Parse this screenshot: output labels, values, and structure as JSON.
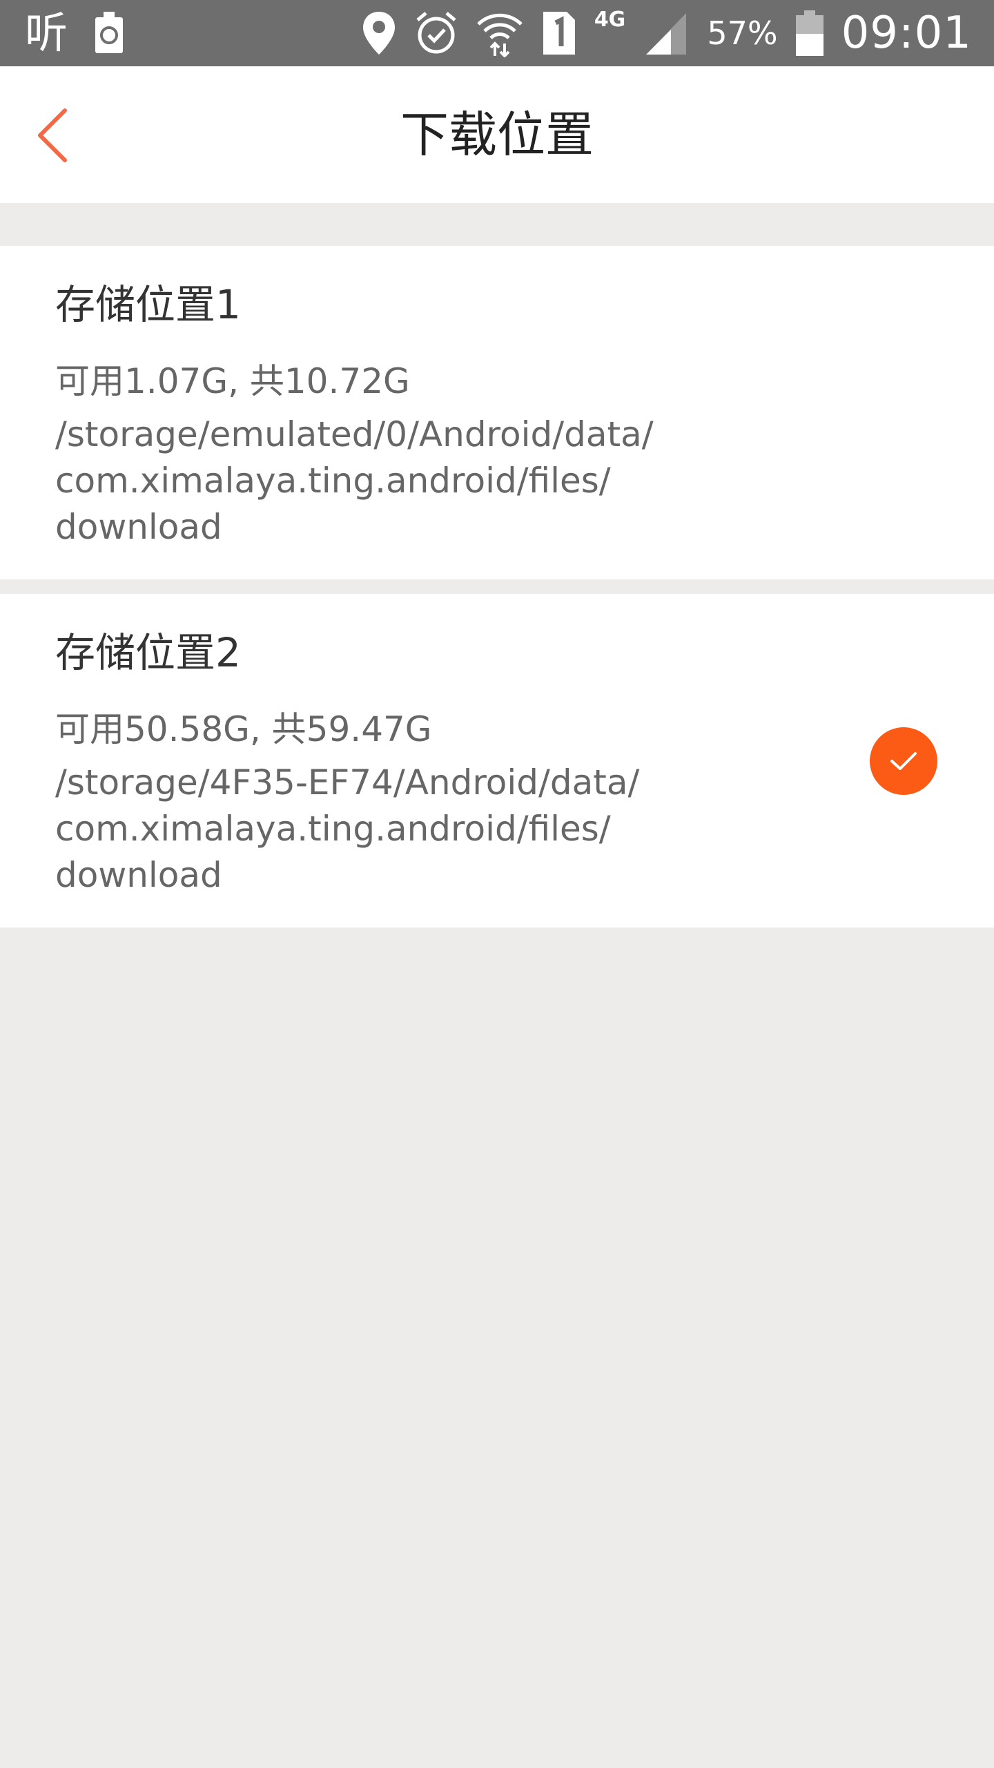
{
  "status_bar": {
    "app_indicator": "听",
    "network_type": "4G",
    "battery_percent": "57%",
    "time": "09:01"
  },
  "header": {
    "title": "下载位置",
    "accent_color": "#f26a45"
  },
  "storage_locations": [
    {
      "title": "存储位置1",
      "space": "可用1.07G, 共10.72G",
      "path_lines": [
        "/storage/emulated/0/Android/data/",
        "com.ximalaya.ting.android/files/",
        "download"
      ],
      "selected": false
    },
    {
      "title": "存储位置2",
      "space": "可用50.58G, 共59.47G",
      "path_lines": [
        "/storage/4F35-EF74/Android/data/",
        "com.ximalaya.ting.android/files/",
        "download"
      ],
      "selected": true
    }
  ],
  "colors": {
    "selected_check": "#fc5b15",
    "background": "#edecea",
    "status_bar": "#6e6e6e"
  }
}
